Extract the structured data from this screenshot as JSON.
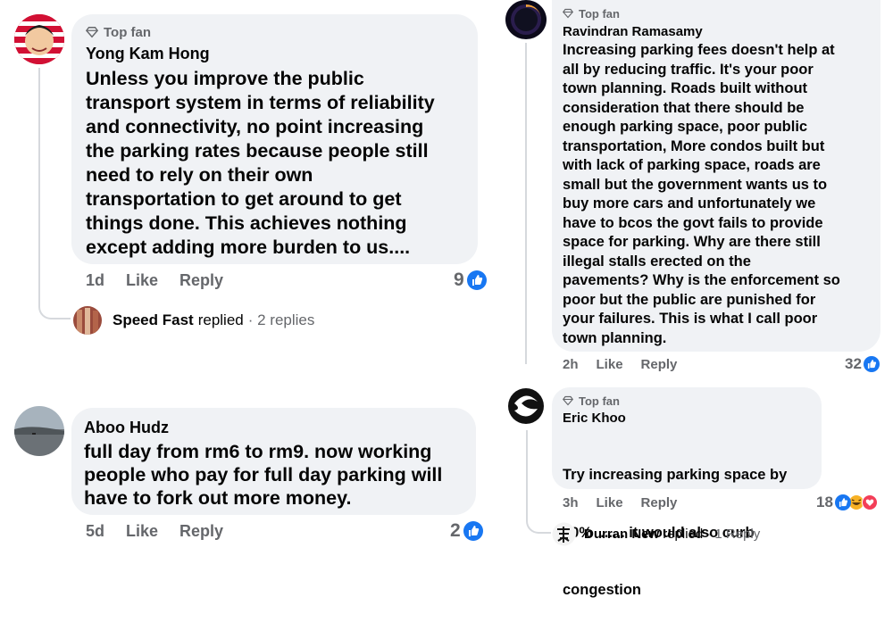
{
  "comment1": {
    "badge": "Top fan",
    "author": "Yong Kam Hong",
    "lines": [
      "Unless you improve the public",
      "transport system in terms of reliability",
      "and connectivity, no point increasing",
      "the parking rates because people still",
      "need to rely on their own",
      "transportation to get around to get",
      "things done. This achieves nothing",
      "except adding more burden to us...."
    ],
    "time": "1d",
    "like": "Like",
    "reply": "Reply",
    "count": "9",
    "replies": {
      "name": "Speed Fast",
      "verb": "replied",
      "summary": "· 2 replies"
    }
  },
  "comment2": {
    "author": "Aboo Hudz",
    "lines": [
      "full day from rm6 to rm9. now working",
      "people who pay for full day parking will",
      "have to fork out more money."
    ],
    "time": "5d",
    "like": "Like",
    "reply": "Reply",
    "count": "2"
  },
  "comment3": {
    "badge": "Top fan",
    "author": "Ravindran Ramasamy",
    "lines": [
      "Increasing parking fees doesn't help at",
      "all by reducing traffic. It's your poor",
      "town planning. Roads built without",
      "consideration that there should be",
      "enough parking space, poor public",
      "transportation, More condos built but",
      "with lack of parking space, roads are",
      "small but the government wants us to",
      "buy more cars and unfortunately we",
      "have to bcos the govt fails to provide",
      "space for parking. Why are there still",
      "illegal stalls erected on the",
      "pavements? Why is the enforcement so",
      "poor but the public are punished for",
      "your failures. This is what I call poor",
      "town planning."
    ],
    "time": "2h",
    "like": "Like",
    "reply": "Reply",
    "count": "32"
  },
  "comment4": {
    "badge": "Top fan",
    "author": "Eric Khoo",
    "lines": [
      "Try increasing parking space by",
      "50%  ...... it would also curb",
      "congestion"
    ],
    "time": "3h",
    "like": "Like",
    "reply": "Reply",
    "count": "18",
    "replies": {
      "name": "Durran New",
      "verb": "replied",
      "summary": "· 1 Reply"
    }
  },
  "colors": {
    "bubble": "#f0f2f5",
    "like_blue": "#1877f2",
    "muted": "#65676b",
    "love_red": "#f33e58",
    "haha_yellow": "#f7b125"
  }
}
